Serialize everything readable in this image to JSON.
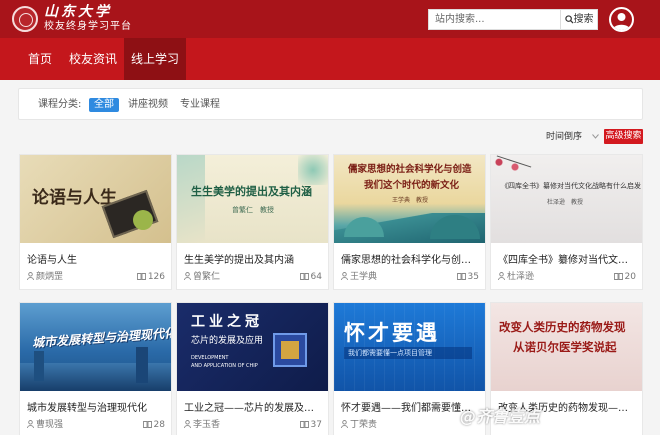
{
  "header": {
    "logo_main": "山东大学",
    "logo_sub": "校友终身学习平台",
    "search_placeholder": "站内搜索...",
    "search_button": "搜索",
    "icons": {
      "search": "search-icon",
      "user": "user-avatar-icon"
    }
  },
  "nav": {
    "items": [
      {
        "label": "首页"
      },
      {
        "label": "校友资讯"
      },
      {
        "label": "线上学习"
      }
    ],
    "active": "线上学习"
  },
  "filter": {
    "label": "课程分类:",
    "options": [
      "全部",
      "讲座视频",
      "专业课程"
    ],
    "selected": "全部"
  },
  "toolbar": {
    "sort_label": "时间倒序",
    "advanced_search": "高级搜索"
  },
  "courses": [
    {
      "title": "论语与人生",
      "teacher": "颜炳罡",
      "lessons": "126",
      "thumb_text": "论语与人生"
    },
    {
      "title": "生生美学的提出及其内涵",
      "teacher": "曾繁仁",
      "lessons": "64",
      "thumb_text": "生生美学的提出及其内涵",
      "thumb_sub": "曾繁仁　教授"
    },
    {
      "title": "儒家思想的社会科学化与创造我们...",
      "teacher": "王学典",
      "lessons": "35",
      "thumb_text": "儒家思想的社会科学化与创造",
      "thumb_text2": "我们这个时代的新文化",
      "thumb_sub": "王学典　教授"
    },
    {
      "title": "《四库全书》纂修对当代文化战略...",
      "teacher": "杜泽逊",
      "lessons": "20",
      "thumb_text": "《四库全书》纂修对当代文化战略有什么启发",
      "thumb_sub": "杜泽逊　教授"
    },
    {
      "title": "城市发展转型与治理现代化",
      "teacher": "曹现强",
      "lessons": "28",
      "thumb_text": "城市发展转型与治理现代化"
    },
    {
      "title": "工业之冠——芯片的发展及应用",
      "teacher": "李玉香",
      "lessons": "37",
      "thumb_text": "工业之冠",
      "thumb_text2": "芯片的发展及应用",
      "thumb_sub": "DEVELOPMENT",
      "thumb_sub2": "AND APPLICATION OF CHIP"
    },
    {
      "title": "怀才要遇——我们都需要懂一点项...",
      "teacher": "丁荣贵",
      "lessons": "",
      "thumb_text": "怀才要遇",
      "thumb_sub": "我们都需要懂一点项目管理"
    },
    {
      "title": "改变人类历史的药物发现——从诺...",
      "teacher": "",
      "lessons": "",
      "thumb_text": "改变人类历史的药物发现",
      "thumb_text2": "从诺贝尔医学奖说起"
    }
  ],
  "watermark": "@齐鲁壹点"
}
